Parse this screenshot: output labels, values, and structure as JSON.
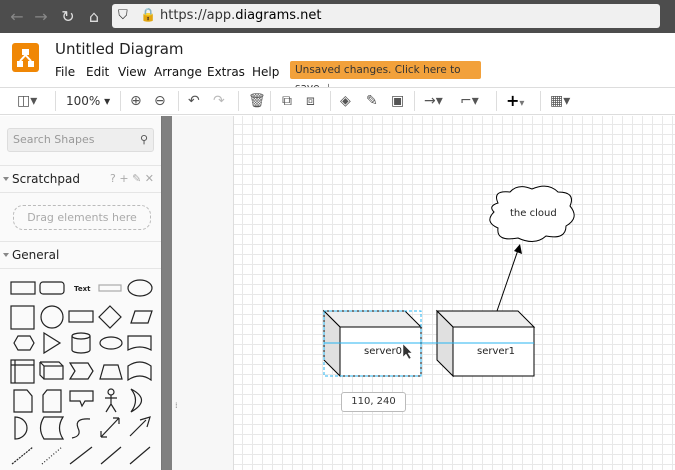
{
  "browser": {
    "url_prefix": "https://app.",
    "url_domain": "diagrams.net"
  },
  "app": {
    "title": "Untitled Diagram",
    "menu": [
      "File",
      "Edit",
      "View",
      "Arrange",
      "Extras",
      "Help"
    ],
    "unsaved": "Unsaved changes. Click here to save.",
    "accent": "#f08705"
  },
  "toolbar": {
    "zoom": "100%"
  },
  "sidebar": {
    "search_placeholder": "Search Shapes",
    "scratchpad": "Scratchpad",
    "scratch_actions": "? + ✎ ✕",
    "drag_hint": "Drag elements here",
    "general": "General",
    "text_shape": "Text"
  },
  "diagram": {
    "server0": "server0",
    "server1": "server1",
    "cloud": "the cloud",
    "tooltip": "110, 240"
  }
}
